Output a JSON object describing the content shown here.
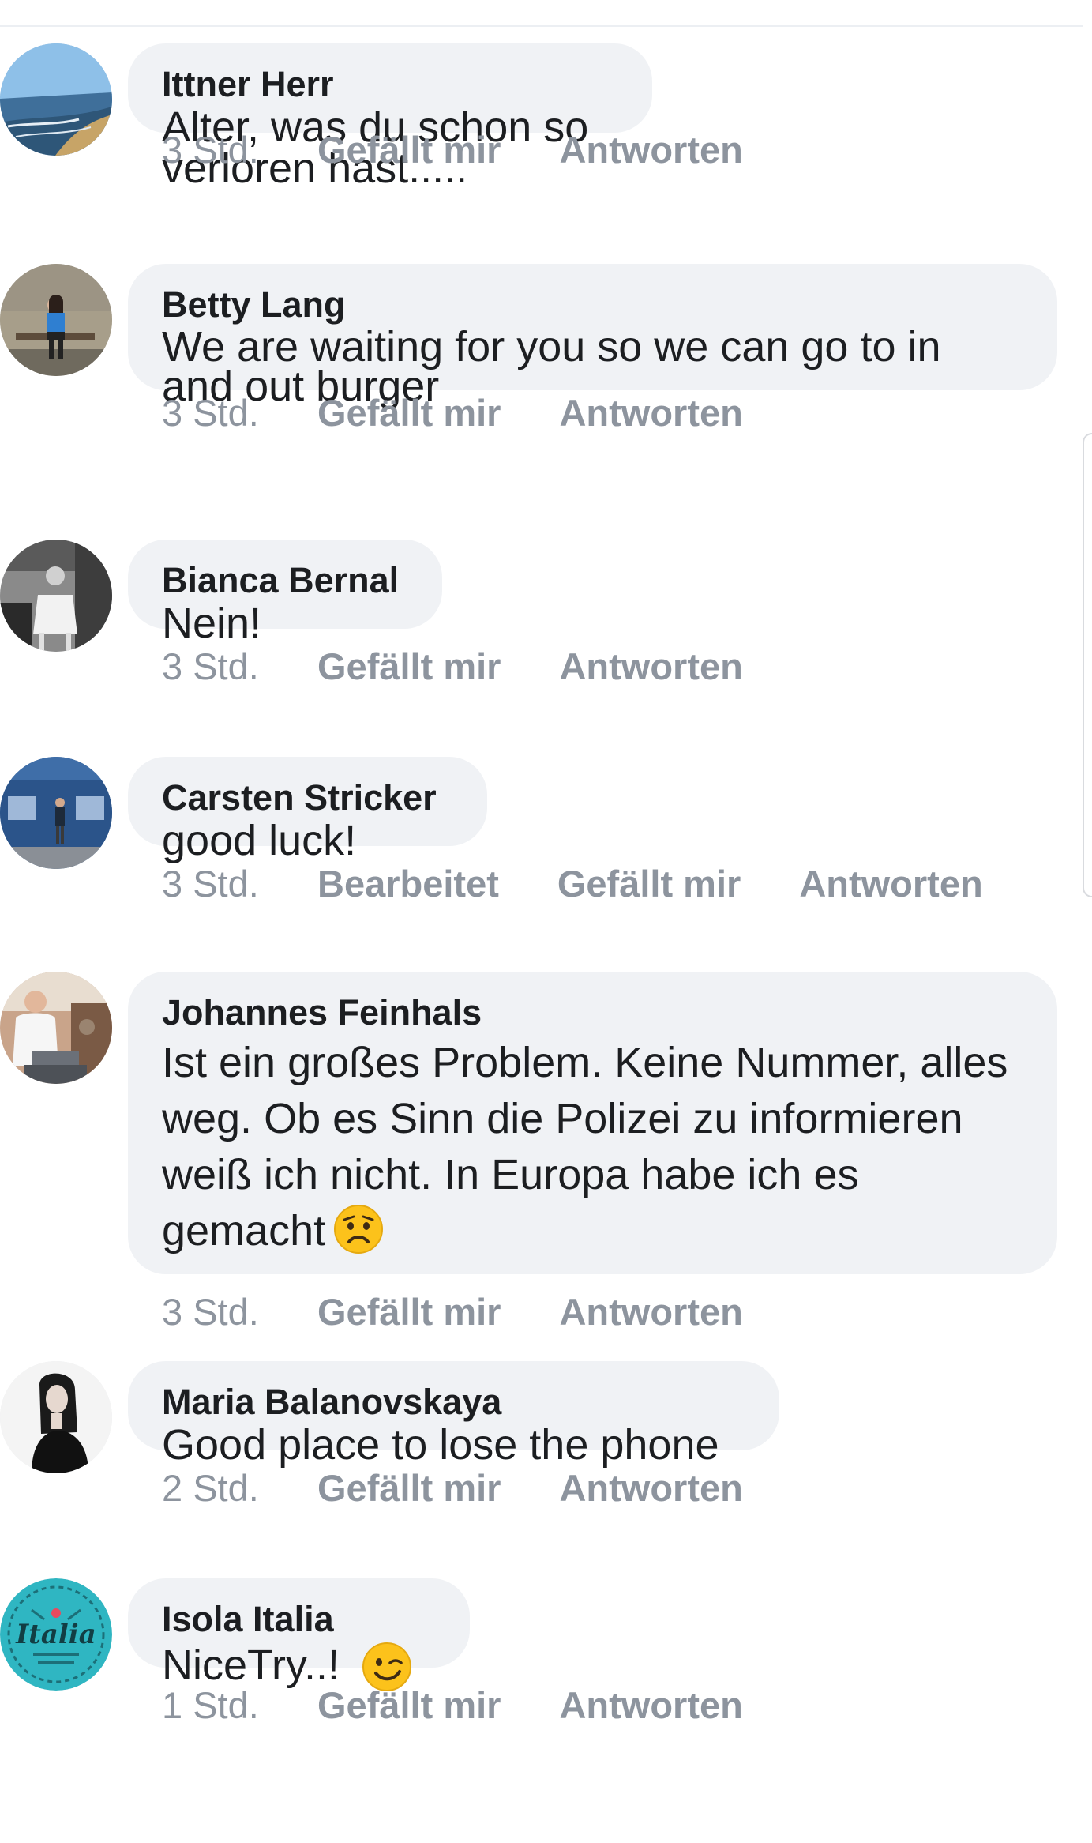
{
  "colors": {
    "bubble_bg": "#f0f2f5",
    "text": "#1c1e21",
    "meta": "#8d949e"
  },
  "comments": [
    {
      "author": "Ittner Herr",
      "text": "Alter, was du schon so verloren hast.....",
      "time": "3 Std.",
      "like": "Gefällt mir",
      "reply": "Antworten",
      "avatar": "beach-coast-avatar"
    },
    {
      "author": "Betty Lang",
      "text": "We are waiting for you so we can go to in and out burger",
      "time": "3 Std.",
      "like": "Gefällt mir",
      "reply": "Antworten",
      "avatar": "woman-on-bench-avatar"
    },
    {
      "author": "Bianca Bernal",
      "text": "Nein!",
      "time": "3 Std.",
      "like": "Gefällt mir",
      "reply": "Antworten",
      "avatar": "black-white-photo-avatar"
    },
    {
      "author": "Carsten Stricker",
      "text": "good luck!",
      "time": "3 Std.",
      "edited": "Bearbeitet",
      "like": "Gefällt mir",
      "reply": "Antworten",
      "avatar": "blue-building-avatar"
    },
    {
      "author": "Johannes Feinhals",
      "text": "Ist ein großes Problem.  Keine Nummer, alles weg. Ob es Sinn die Polizei zu informieren weiß ich nicht. In Europa habe ich es gemacht",
      "emoji": "worried-face-emoji",
      "time": "3 Std.",
      "like": "Gefällt mir",
      "reply": "Antworten",
      "avatar": "chef-kitchen-avatar"
    },
    {
      "author": "Maria Balanovskaya",
      "text": "Good place to lose the phone",
      "time": "2 Std.",
      "like": "Gefällt mir",
      "reply": "Antworten",
      "avatar": "woman-portrait-avatar"
    },
    {
      "author": "Isola Italia",
      "text": "NiceTry..!",
      "emoji": "winking-face-emoji",
      "time": "1 Std.",
      "like": "Gefällt mir",
      "reply": "Antworten",
      "avatar": "isola-italia-logo-avatar",
      "logo_text": "Italia"
    }
  ]
}
